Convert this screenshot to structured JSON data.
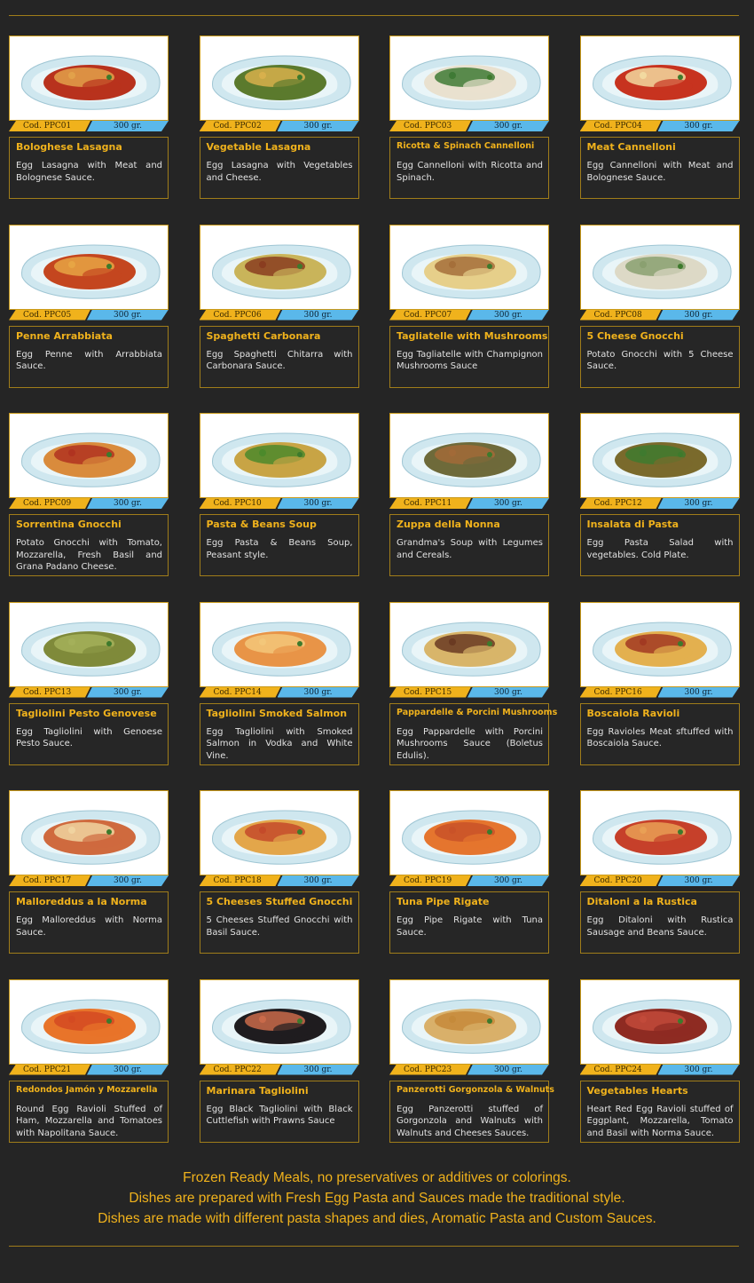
{
  "colors": {
    "accent": "#f0b21c",
    "weight_tag": "#5ab8ea",
    "background": "#252525",
    "text": "#e2e2e2"
  },
  "dishes": [
    {
      "code": "Cod.  PPC01",
      "weight": "300 gr.",
      "name": "Bologhese Lasagna",
      "description": "Egg Lasagna with Meat and Bolognese Sauce."
    },
    {
      "code": "Cod.  PPC02",
      "weight": "300 gr.",
      "name": "Vegetable Lasagna",
      "description": "Egg Lasagna with Vegetables and Cheese."
    },
    {
      "code": "Cod.  PPC03",
      "weight": "300 gr.",
      "name": "Ricotta & Spinach Cannelloni",
      "description": "Egg Cannelloni with Ricotta and Spinach."
    },
    {
      "code": "Cod.  PPC04",
      "weight": "300 gr.",
      "name": "Meat Cannelloni",
      "description": "Egg Cannelloni with Meat and Bolognese Sauce."
    },
    {
      "code": "Cod.  PPC05",
      "weight": "300 gr.",
      "name": "Penne  Arrabbiata",
      "description": "Egg Penne with Arrabbiata Sauce."
    },
    {
      "code": "Cod.  PPC06",
      "weight": "300 gr.",
      "name": "Spaghetti Carbonara",
      "description": "Egg Spaghetti Chitarra with Carbonara Sauce."
    },
    {
      "code": "Cod.  PPC07",
      "weight": "300 gr.",
      "name": "Tagliatelle with Mushrooms",
      "description": "Egg Tagliatelle with Champignon Mushrooms Sauce"
    },
    {
      "code": "Cod.  PPC08",
      "weight": "300 gr.",
      "name": "5 Cheese Gnocchi",
      "description": "Potato Gnocchi with 5 Cheese Sauce."
    },
    {
      "code": "Cod.  PPC09",
      "weight": "300 gr.",
      "name": "Sorrentina Gnocchi",
      "description": "Potato Gnocchi with Tomato, Mozzarella, Fresh Basil and Grana Padano Cheese."
    },
    {
      "code": "Cod.  PPC10",
      "weight": "300 gr.",
      "name": "Pasta & Beans Soup",
      "description": "Egg Pasta & Beans Soup, Peasant style."
    },
    {
      "code": "Cod.  PPC11",
      "weight": "300 gr.",
      "name": "Zuppa della Nonna",
      "description": "Grandma's Soup with Legumes and Cereals."
    },
    {
      "code": "Cod.  PPC12",
      "weight": "300 gr.",
      "name": "Insalata di Pasta",
      "description": "Egg Pasta Salad with vegetables. Cold Plate."
    },
    {
      "code": "Cod.  PPC13",
      "weight": "300 gr.",
      "name": "Tagliolini Pesto Genovese",
      "description": "Egg Tagliolini with Genoese Pesto Sauce."
    },
    {
      "code": "Cod.  PPC14",
      "weight": "300 gr.",
      "name": "Tagliolini Smoked Salmon",
      "description": "Egg Tagliolini with Smoked Salmon in Vodka and White Vine."
    },
    {
      "code": "Cod.  PPC15",
      "weight": "300 gr.",
      "name": "Pappardelle & Porcini Mushrooms",
      "description": "Egg Pappardelle with Porcini Mushrooms Sauce (Boletus Edulis)."
    },
    {
      "code": "Cod.  PPC16",
      "weight": "300 gr.",
      "name": "Boscaiola Ravioli",
      "description": "Egg Ravioles Meat sftuffed with Boscaiola Sauce."
    },
    {
      "code": "Cod.  PPC17",
      "weight": "300 gr.",
      "name": "Malloreddus a la Norma",
      "description": "Egg Malloreddus with Norma Sauce."
    },
    {
      "code": "Cod.  PPC18",
      "weight": "300 gr.",
      "name": "5 Cheeses Stuffed Gnocchi",
      "description": "5 Cheeses Stuffed Gnocchi with Basil Sauce."
    },
    {
      "code": "Cod.  PPC19",
      "weight": "300 gr.",
      "name": "Tuna Pipe Rigate",
      "description": "Egg Pipe Rigate with Tuna Sauce."
    },
    {
      "code": "Cod.  PPC20",
      "weight": "300 gr.",
      "name": "Ditaloni a la Rustica",
      "description": "Egg Ditaloni with Rustica Sausage and Beans Sauce."
    },
    {
      "code": "Cod.  PPC21",
      "weight": "300 gr.",
      "name": "Redondos Jamón y Mozzarella",
      "description": "Round Egg Ravioli Stuffed of Ham, Mozzarella and Tomatoes with Napolitana Sauce."
    },
    {
      "code": "Cod.  PPC22",
      "weight": "300 gr.",
      "name": "Marinara Tagliolini",
      "description": "Egg Black Tagliolini with Black Cuttlefish with Prawns Sauce"
    },
    {
      "code": "Cod.  PPC23",
      "weight": "300 gr.",
      "name": "Panzerotti Gorgonzola & Walnuts",
      "description": "Egg Panzerotti stuffed of Gorgonzola and Walnuts with Walnuts and Cheeses Sauces."
    },
    {
      "code": "Cod.  PPC24",
      "weight": "300 gr.",
      "name": "Vegetables Hearts",
      "description": "Heart Red Egg Ravioli stuffed of Eggplant, Mozzarella, Tomato and Basil with Norma Sauce."
    }
  ],
  "footer": {
    "line1": "Frozen Ready Meals, no preservatives or additives or colorings.",
    "line2": "Dishes are prepared with Fresh Egg Pasta and Sauces made the traditional style.",
    "line3": "Dishes are made with different pasta shapes and dies, Aromatic Pasta and Custom Sauces."
  }
}
